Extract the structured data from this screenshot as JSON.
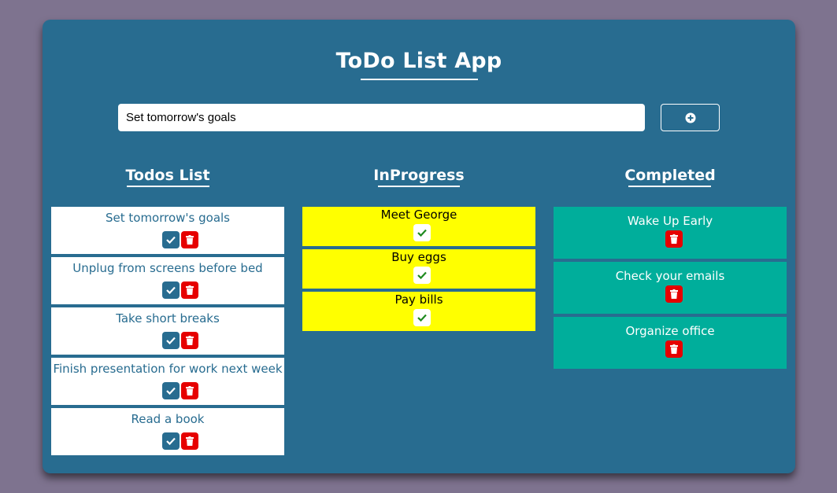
{
  "app": {
    "title": "ToDo List App"
  },
  "input": {
    "value": "Set tomorrow's goals",
    "add_icon": "plus-circle-icon"
  },
  "columns": {
    "todos": {
      "title": "Todos List",
      "items": [
        "Set tomorrow's goals",
        "Unplug from screens before bed",
        "Take short breaks",
        "Finish presentation for work next week",
        "Read a book"
      ]
    },
    "inprogress": {
      "title": "InProgress",
      "items": [
        "Meet George",
        "Buy eggs",
        "Pay bills"
      ]
    },
    "completed": {
      "title": "Completed",
      "items": [
        "Wake Up Early",
        "Check your emails",
        "Organize office"
      ]
    }
  },
  "colors": {
    "background": "#7e738f",
    "app": "#286c90",
    "todo_card": "#ffffff",
    "inprogress_card": "#ffff00",
    "completed_card": "#00ae9b",
    "delete": "#e60000",
    "check_green": "#1e8a1e"
  }
}
